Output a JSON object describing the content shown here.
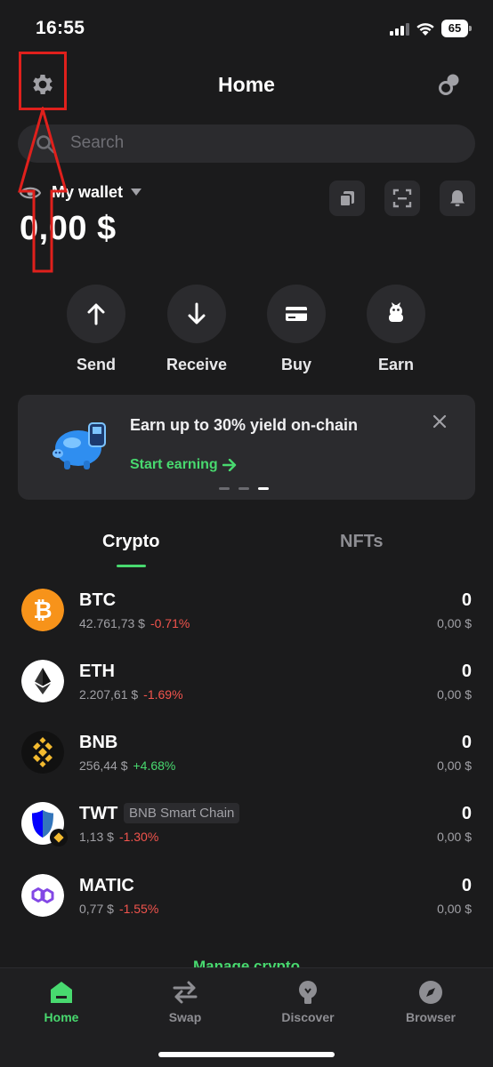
{
  "status_bar": {
    "time": "16:55",
    "battery": "65"
  },
  "header": {
    "title": "Home",
    "settings_icon": "gear-icon",
    "connect_icon": "link-icon"
  },
  "search": {
    "placeholder": "Search"
  },
  "wallet": {
    "name": "My wallet",
    "balance": "0,00 $"
  },
  "actions": [
    {
      "label": "Send",
      "icon": "arrow-up-icon"
    },
    {
      "label": "Receive",
      "icon": "arrow-down-icon"
    },
    {
      "label": "Buy",
      "icon": "card-icon"
    },
    {
      "label": "Earn",
      "icon": "piggy-icon"
    }
  ],
  "banner": {
    "title": "Earn up to 30% yield on-chain",
    "link": "Start earning",
    "pages": 3,
    "active_page": 3
  },
  "tabs": [
    {
      "label": "Crypto",
      "active": true
    },
    {
      "label": "NFTs",
      "active": false
    }
  ],
  "assets": [
    {
      "symbol": "BTC",
      "price": "42.761,73 $",
      "change": "-0.71%",
      "amount": "0",
      "fiat": "0,00 $",
      "color": "#f7931a"
    },
    {
      "symbol": "ETH",
      "price": "2.207,61 $",
      "change": "-1.69%",
      "amount": "0",
      "fiat": "0,00 $",
      "color": "#ffffff"
    },
    {
      "symbol": "BNB",
      "price": "256,44 $",
      "change": "+4.68%",
      "amount": "0",
      "fiat": "0,00 $",
      "color": "#f3ba2f"
    },
    {
      "symbol": "TWT",
      "chain": "BNB Smart Chain",
      "price": "1,13 $",
      "change": "-1.30%",
      "amount": "0",
      "fiat": "0,00 $",
      "color": "#3375bb"
    },
    {
      "symbol": "MATIC",
      "price": "0,77 $",
      "change": "-1.55%",
      "amount": "0",
      "fiat": "0,00 $",
      "color": "#8247e5"
    }
  ],
  "manage_link": "Manage crypto",
  "nav": [
    {
      "label": "Home",
      "active": true
    },
    {
      "label": "Swap",
      "active": false
    },
    {
      "label": "Discover",
      "active": false
    },
    {
      "label": "Browser",
      "active": false
    }
  ],
  "colors": {
    "accent": "#48d96f",
    "negative": "#f2544d",
    "background": "#1b1b1c",
    "annotation": "#e0201c"
  }
}
